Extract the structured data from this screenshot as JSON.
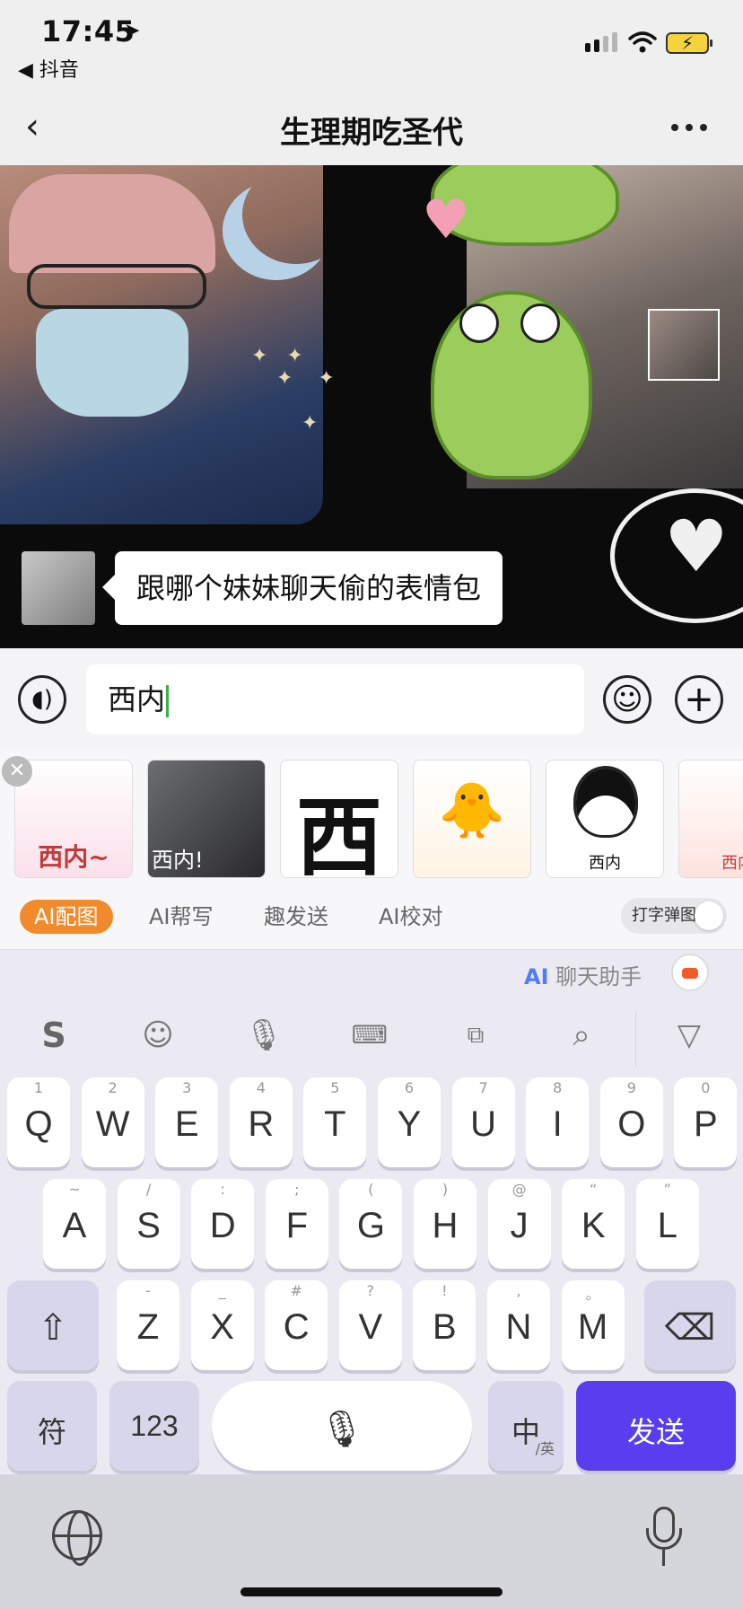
{
  "status": {
    "time": "17:45",
    "back_app": "◀ 抖音"
  },
  "nav": {
    "title": "生理期吃圣代"
  },
  "chat": {
    "message": "跟哪个妹妹聊天偷的表情包"
  },
  "input": {
    "value": "西内"
  },
  "stickers": [
    {
      "label": "西内~"
    },
    {
      "label": "西内!"
    },
    {
      "label": "西"
    },
    {
      "label": ""
    },
    {
      "label": "西内"
    },
    {
      "label": "西内"
    }
  ],
  "ai_tabs": {
    "items": [
      "AI配图",
      "AI帮写",
      "趣发送",
      "AI校对"
    ],
    "active": "AI配图",
    "toggle_label": "打字弹图"
  },
  "keyboard": {
    "assistant_ai": "AI",
    "assistant_label": "聊天助手",
    "row1": [
      {
        "main": "Q",
        "sub": "1"
      },
      {
        "main": "W",
        "sub": "2"
      },
      {
        "main": "E",
        "sub": "3"
      },
      {
        "main": "R",
        "sub": "4"
      },
      {
        "main": "T",
        "sub": "5"
      },
      {
        "main": "Y",
        "sub": "6"
      },
      {
        "main": "U",
        "sub": "7"
      },
      {
        "main": "I",
        "sub": "8"
      },
      {
        "main": "O",
        "sub": "9"
      },
      {
        "main": "P",
        "sub": "0"
      }
    ],
    "row2": [
      {
        "main": "A",
        "sub": "~"
      },
      {
        "main": "S",
        "sub": "/"
      },
      {
        "main": "D",
        "sub": ":"
      },
      {
        "main": "F",
        "sub": ";"
      },
      {
        "main": "G",
        "sub": "("
      },
      {
        "main": "H",
        "sub": ")"
      },
      {
        "main": "J",
        "sub": "@"
      },
      {
        "main": "K",
        "sub": "“"
      },
      {
        "main": "L",
        "sub": "”"
      }
    ],
    "row3": [
      {
        "main": "Z",
        "sub": "-"
      },
      {
        "main": "X",
        "sub": "_"
      },
      {
        "main": "C",
        "sub": "#"
      },
      {
        "main": "V",
        "sub": "?"
      },
      {
        "main": "B",
        "sub": "!"
      },
      {
        "main": "N",
        "sub": ","
      },
      {
        "main": "M",
        "sub": "。"
      }
    ],
    "symbol_label": "符",
    "number_label": "123",
    "lang_label": "中",
    "lang_sub": "/英",
    "send_label": "发送"
  },
  "colors": {
    "accent_orange": "#f08a2a",
    "send_purple": "#5b3df0",
    "caret_green": "#37b24a"
  }
}
